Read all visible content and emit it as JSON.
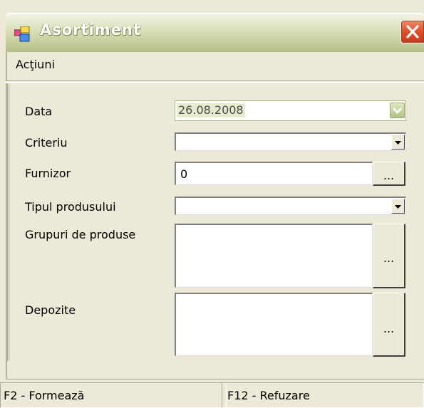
{
  "window": {
    "title": "Asortiment"
  },
  "menu": {
    "items": [
      {
        "label": "Acţiuni"
      }
    ]
  },
  "form": {
    "fields": [
      {
        "label": "Data",
        "value": "26.08.2008"
      },
      {
        "label": "Criteriu",
        "value": ""
      },
      {
        "label": "Furnizor",
        "value": "0"
      },
      {
        "label": "Tipul produsului",
        "value": ""
      },
      {
        "label": "Grupuri de produse",
        "value": ""
      },
      {
        "label": "Depozite",
        "value": ""
      }
    ],
    "browse_label": "..."
  },
  "status": {
    "panels": [
      {
        "text": "F2 - Formează"
      },
      {
        "text": "F12 - Refuzare"
      }
    ]
  },
  "icons": {
    "app": "app-window-icon",
    "close": "close-icon",
    "dropdown": "chevron-down-icon"
  },
  "colors": {
    "title_gradient_top": "#f2f4e4",
    "title_gradient_bottom": "#b7c08a",
    "close_red": "#e0532e",
    "window_face": "#ece9d8",
    "selected_date_bg": "#e6ecce"
  }
}
